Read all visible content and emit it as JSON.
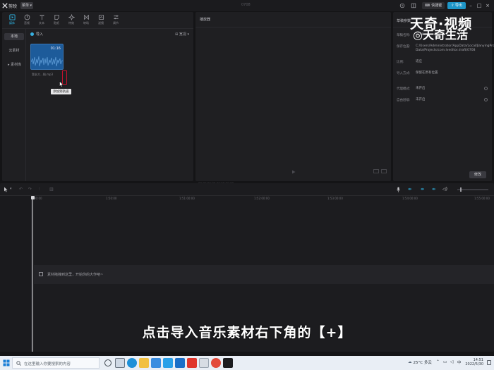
{
  "titlebar": {
    "app_name": "剪映",
    "menu_label": "菜单",
    "project_title": "0708",
    "shortcut_label": "快捷键",
    "export_label": "导出"
  },
  "media_panel": {
    "tabs": [
      {
        "label": "媒体",
        "icon": "media-icon",
        "active": true
      },
      {
        "label": "音频",
        "icon": "audio-icon",
        "active": false
      },
      {
        "label": "文本",
        "icon": "text-icon",
        "active": false
      },
      {
        "label": "贴纸",
        "icon": "sticker-icon",
        "active": false
      },
      {
        "label": "特效",
        "icon": "effects-icon",
        "active": false
      },
      {
        "label": "转场",
        "icon": "transition-icon",
        "active": false
      },
      {
        "label": "滤镜",
        "icon": "filter-icon",
        "active": false
      },
      {
        "label": "调节",
        "icon": "adjust-icon",
        "active": false
      }
    ],
    "sidebar": {
      "local": "本地",
      "cloud": "云素材",
      "library": "▸ 素材库"
    },
    "import_label": "导入",
    "sort_label": "⊞ 宽视 ▾",
    "item": {
      "duration": "01:16",
      "filename": "我长大...指.mp3",
      "add_glyph": "+",
      "tooltip": "添加到轨道"
    }
  },
  "player": {
    "title": "播放器",
    "time": "00:00:00:00  00:00:00:00  ▾"
  },
  "properties": {
    "title": "草稿参数",
    "rows": [
      {
        "label": "草稿名称:",
        "value": "0708"
      },
      {
        "label": "保存位置:",
        "value": "C:/Users/Administrator/AppData/Local/JianyingPro/User Data/Projects/com.lveditor.draft/0708"
      },
      {
        "label": "比例:",
        "value": "适应"
      },
      {
        "label": "导入方式:",
        "value": "保留在原有位置"
      },
      {
        "label": "代理模式:",
        "value": "未开启"
      },
      {
        "label": "自由层级:",
        "value": "未开启"
      }
    ],
    "modify_label": "修改"
  },
  "watermark": {
    "main": "天奇·视频",
    "sub": "◎天奇生活"
  },
  "timeline": {
    "ticks": [
      "00:00",
      "1:50:00",
      "1:51:00:00",
      "1:52:00:00",
      "1:53:00:00",
      "1:54:00:00",
      "1:55:00:00"
    ],
    "drop_hint": "素材拖拽到这里，开始你的大作吧~"
  },
  "subtitle": "点击导入音乐素材右下角的【+】",
  "taskbar": {
    "search_placeholder": "在这里输入你要搜索的内容",
    "weather": "25°C 多云",
    "lang": "中",
    "time": "14:51",
    "date": "2022/5/30"
  }
}
